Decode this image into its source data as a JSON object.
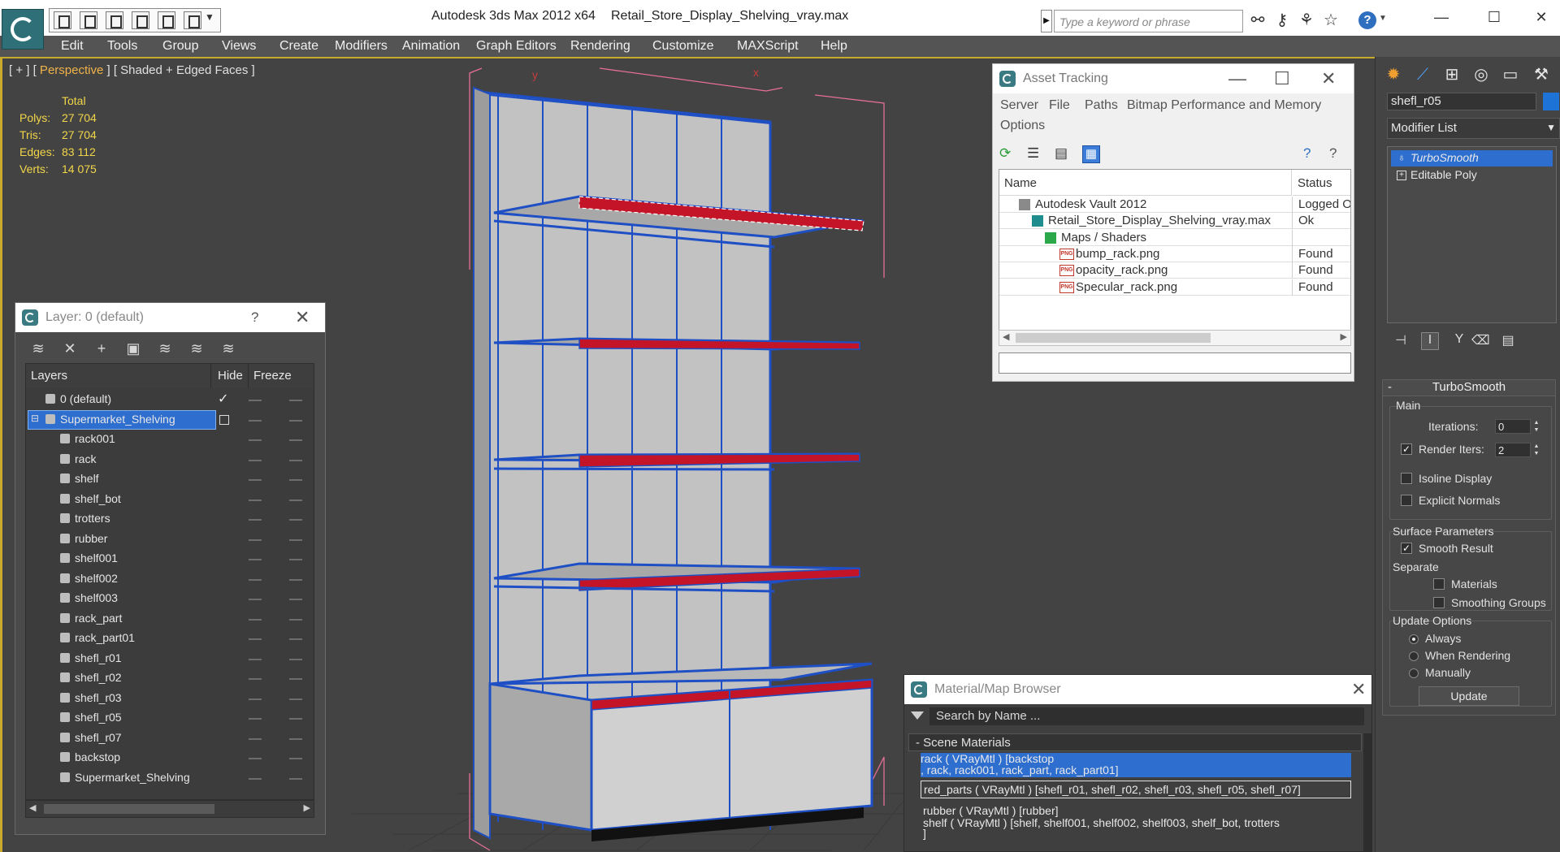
{
  "title_bar": {
    "app_title": "Autodesk 3ds Max  2012 x64",
    "file_title": "Retail_Store_Display_Shelving_vray.max",
    "search_placeholder": "Type a keyword or phrase",
    "icons": [
      "binoculars-icon",
      "key-icon",
      "satellite-icon",
      "star-icon",
      "help-icon"
    ],
    "window_controls": [
      "minimize",
      "maximize",
      "close"
    ]
  },
  "menu": [
    "Edit",
    "Tools",
    "Group",
    "Views",
    "Create",
    "Modifiers",
    "Animation",
    "Graph Editors",
    "Rendering",
    "Customize",
    "MAXScript",
    "Help"
  ],
  "viewport": {
    "label_prefix": "[ + ] [",
    "label_view": " Perspective ",
    "label_suffix": "] [ Shaded + Edged Faces ]",
    "stats_header": "Total",
    "stats": [
      {
        "label": "Polys:",
        "value": "27 704"
      },
      {
        "label": "Tris:",
        "value": "27 704"
      },
      {
        "label": "Edges:",
        "value": "83 112"
      },
      {
        "label": "Verts:",
        "value": "14 075"
      }
    ],
    "axis_labels": {
      "y": "y",
      "x": "x"
    }
  },
  "layer_dialog": {
    "title": "Layer: 0 (default)",
    "help": "?",
    "columns": [
      "Layers",
      "Hide",
      "Freeze"
    ],
    "rows": [
      {
        "name": "0 (default)",
        "kind": "layer",
        "active": true
      },
      {
        "name": "Supermarket_Shelving",
        "kind": "layer",
        "selected": true
      },
      {
        "name": "rack001",
        "kind": "object"
      },
      {
        "name": "rack",
        "kind": "object"
      },
      {
        "name": "shelf",
        "kind": "object"
      },
      {
        "name": "shelf_bot",
        "kind": "object"
      },
      {
        "name": "trotters",
        "kind": "object"
      },
      {
        "name": "rubber",
        "kind": "object"
      },
      {
        "name": "shelf001",
        "kind": "object"
      },
      {
        "name": "shelf002",
        "kind": "object"
      },
      {
        "name": "shelf003",
        "kind": "object"
      },
      {
        "name": "rack_part",
        "kind": "object"
      },
      {
        "name": "rack_part01",
        "kind": "object"
      },
      {
        "name": "shefl_r01",
        "kind": "object"
      },
      {
        "name": "shefl_r02",
        "kind": "object"
      },
      {
        "name": "shefl_r03",
        "kind": "object"
      },
      {
        "name": "shefl_r05",
        "kind": "object"
      },
      {
        "name": "shefl_r07",
        "kind": "object"
      },
      {
        "name": "backstop",
        "kind": "object"
      },
      {
        "name": "Supermarket_Shelving",
        "kind": "object"
      }
    ]
  },
  "asset_dialog": {
    "title": "Asset Tracking",
    "menu": [
      "Server",
      "File",
      "Paths",
      "Bitmap Performance and Memory",
      "Options"
    ],
    "columns": [
      "Name",
      "Status"
    ],
    "rows": [
      {
        "name": "Autodesk Vault 2012",
        "status": "Logged O"
      },
      {
        "name": "Retail_Store_Display_Shelving_vray.max",
        "status": "Ok"
      },
      {
        "name": "Maps / Shaders",
        "status": ""
      },
      {
        "name": "bump_rack.png",
        "status": "Found"
      },
      {
        "name": "opacity_rack.png",
        "status": "Found"
      },
      {
        "name": "Specular_rack.png",
        "status": "Found"
      }
    ]
  },
  "material_browser": {
    "title": "Material/Map Browser",
    "search_placeholder": "Search by Name ...",
    "section": "- Scene Materials",
    "items": [
      {
        "line1": "rack  ( VRayMtl ) [backstop",
        "line2": ", rack, rack001, rack_part, rack_part01]"
      },
      {
        "line1": "red_parts  ( VRayMtl ) [shefl_r01, shefl_r02, shefl_r03, shefl_r05, shefl_r07]"
      },
      {
        "line1": "rubber  ( VRayMtl ) [rubber]"
      },
      {
        "line1": "shelf  ( VRayMtl ) [shelf, shelf001, shelf002, shelf003, shelf_bot, trotters",
        "line2": "]"
      }
    ]
  },
  "command_panel": {
    "object_name": "shefl_r05",
    "object_color": "#1e73d6",
    "modifier_list": "Modifier List",
    "stack": [
      "TurboSmooth",
      "Editable Poly"
    ],
    "rollout": {
      "title": "TurboSmooth",
      "main_label": "Main",
      "iterations_label": "Iterations:",
      "iterations": "0",
      "render_iters_label": "Render Iters:",
      "render_iters": "2",
      "render_iters_checked": true,
      "isoline_label": "Isoline Display",
      "isoline_checked": false,
      "explicit_label": "Explicit Normals",
      "explicit_checked": false,
      "surface_label": "Surface Parameters",
      "smooth_result_label": "Smooth Result",
      "smooth_result_checked": true,
      "separate_label": "Separate",
      "materials_label": "Materials",
      "materials_checked": false,
      "smoothing_groups_label": "Smoothing Groups",
      "smoothing_groups_checked": false,
      "update_options_label": "Update Options",
      "update_options": [
        "Always",
        "When Rendering",
        "Manually"
      ],
      "update_selected": "Always",
      "update_button": "Update"
    }
  },
  "colors": {
    "viewport_bg": "#434343",
    "selection_blue": "#2e6ecf",
    "wire_blue": "#1f4fc4",
    "red_parts": "#c41428",
    "stats_yellow": "#f2d64a",
    "perspective_orange": "#f0b34a"
  }
}
